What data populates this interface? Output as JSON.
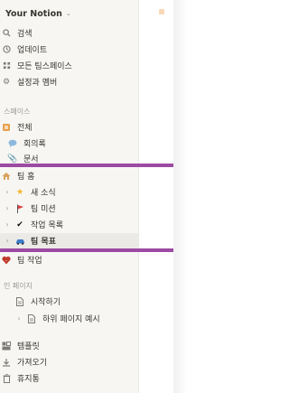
{
  "workspace": {
    "name": "Your Notion"
  },
  "nav": {
    "search": "검색",
    "updates": "업데이트",
    "all_teamspaces": "모든 팀스페이스",
    "settings": "설정과 멤버"
  },
  "teamspace": {
    "section_label": "스페이스",
    "all": "전체",
    "meeting_notes": "회의록",
    "documents": "문서",
    "team_home": "팀 홈",
    "news": "새 소식",
    "team_mission": "팀 미션",
    "task_list": "작업 목록",
    "team_goals": "팀 목표",
    "team_tasks": "팀 작업"
  },
  "private": {
    "section_label": "인 페이지",
    "getting_started": "시작하기",
    "subpage_example": "하위 페이지 예시"
  },
  "footer": {
    "templates": "템플릿",
    "import": "가져오기",
    "trash": "휴지통"
  },
  "colors": {
    "sidebar_bg": "#f7f6f3",
    "highlight_bar": "#9c4aa3",
    "selected_row": "#ebeae6"
  }
}
